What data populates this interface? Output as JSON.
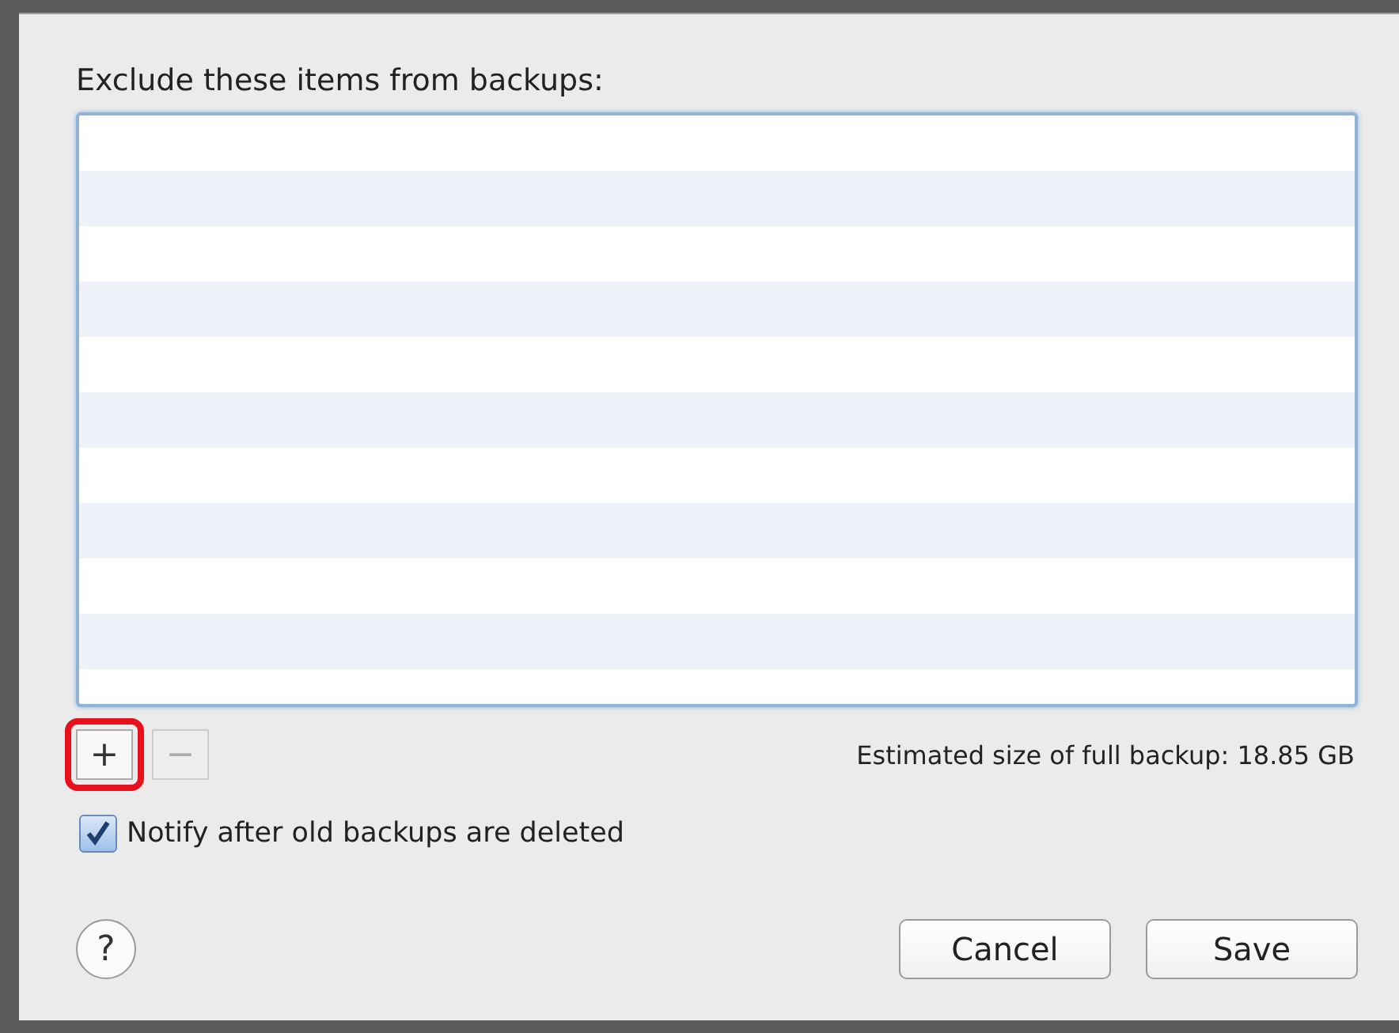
{
  "sheet": {
    "list_label": "Exclude these items from backups:",
    "add_button": {
      "label": "+",
      "highlighted": true
    },
    "remove_button": {
      "label": "−",
      "disabled": true
    },
    "estimate": "Estimated size of full backup: 18.85 GB",
    "notify": {
      "label": "Notify after old backups are deleted",
      "checked": true
    },
    "help_button": {
      "label": "?"
    },
    "buttons": [
      {
        "label": "Cancel"
      },
      {
        "label": "Save"
      }
    ]
  }
}
